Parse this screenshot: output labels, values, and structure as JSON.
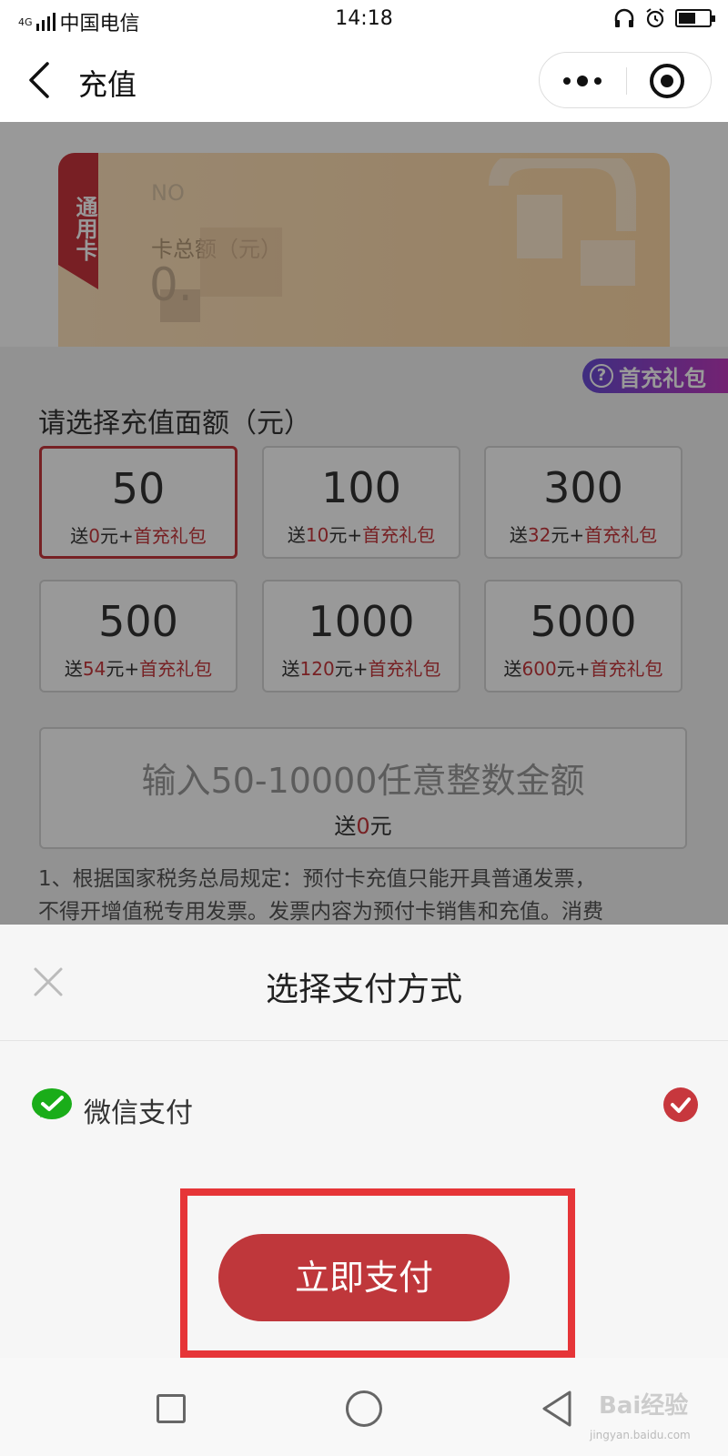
{
  "status_bar": {
    "network": "4G",
    "carrier": "中国电信",
    "time": "14:18"
  },
  "nav": {
    "title": "充值"
  },
  "card": {
    "ribbon": "通用卡",
    "number_label": "NO",
    "balance_label": "卡总额（元）",
    "balance": "0."
  },
  "gift_badge": "首充礼包",
  "amount_section": {
    "title": "请选择充值面额（元）",
    "options": [
      {
        "value": "50",
        "bonus_prefix": "送",
        "bonus_amount": "0",
        "bonus_suffix": "元+",
        "gift": "首充礼包",
        "selected": true
      },
      {
        "value": "100",
        "bonus_prefix": "送",
        "bonus_amount": "10",
        "bonus_suffix": "元+",
        "gift": "首充礼包",
        "selected": false
      },
      {
        "value": "300",
        "bonus_prefix": "送",
        "bonus_amount": "32",
        "bonus_suffix": "元+",
        "gift": "首充礼包",
        "selected": false
      },
      {
        "value": "500",
        "bonus_prefix": "送",
        "bonus_amount": "54",
        "bonus_suffix": "元+",
        "gift": "首充礼包",
        "selected": false
      },
      {
        "value": "1000",
        "bonus_prefix": "送",
        "bonus_amount": "120",
        "bonus_suffix": "元+",
        "gift": "首充礼包",
        "selected": false
      },
      {
        "value": "5000",
        "bonus_prefix": "送",
        "bonus_amount": "600",
        "bonus_suffix": "元+",
        "gift": "首充礼包",
        "selected": false
      }
    ],
    "custom": {
      "placeholder": "输入50-10000任意整数金额",
      "bonus_prefix": "送",
      "bonus_amount": "0",
      "bonus_suffix": "元"
    }
  },
  "notice": {
    "line1": "1、根据国家税务总局规定：预付卡充值只能开具普通发票，",
    "line2": "不得开增值税专用发票。发票内容为预付卡销售和充值。消费"
  },
  "payment_sheet": {
    "title": "选择支付方式",
    "method_label": "微信支付",
    "pay_button": "立即支付"
  },
  "watermark": {
    "text": "Bai经验",
    "sub": "jingyan.baidu.com"
  },
  "colors": {
    "accent_red": "#bf373b",
    "selected_border": "#c7373d",
    "highlight_box": "#e63538",
    "wechat_green": "#1aad19"
  }
}
